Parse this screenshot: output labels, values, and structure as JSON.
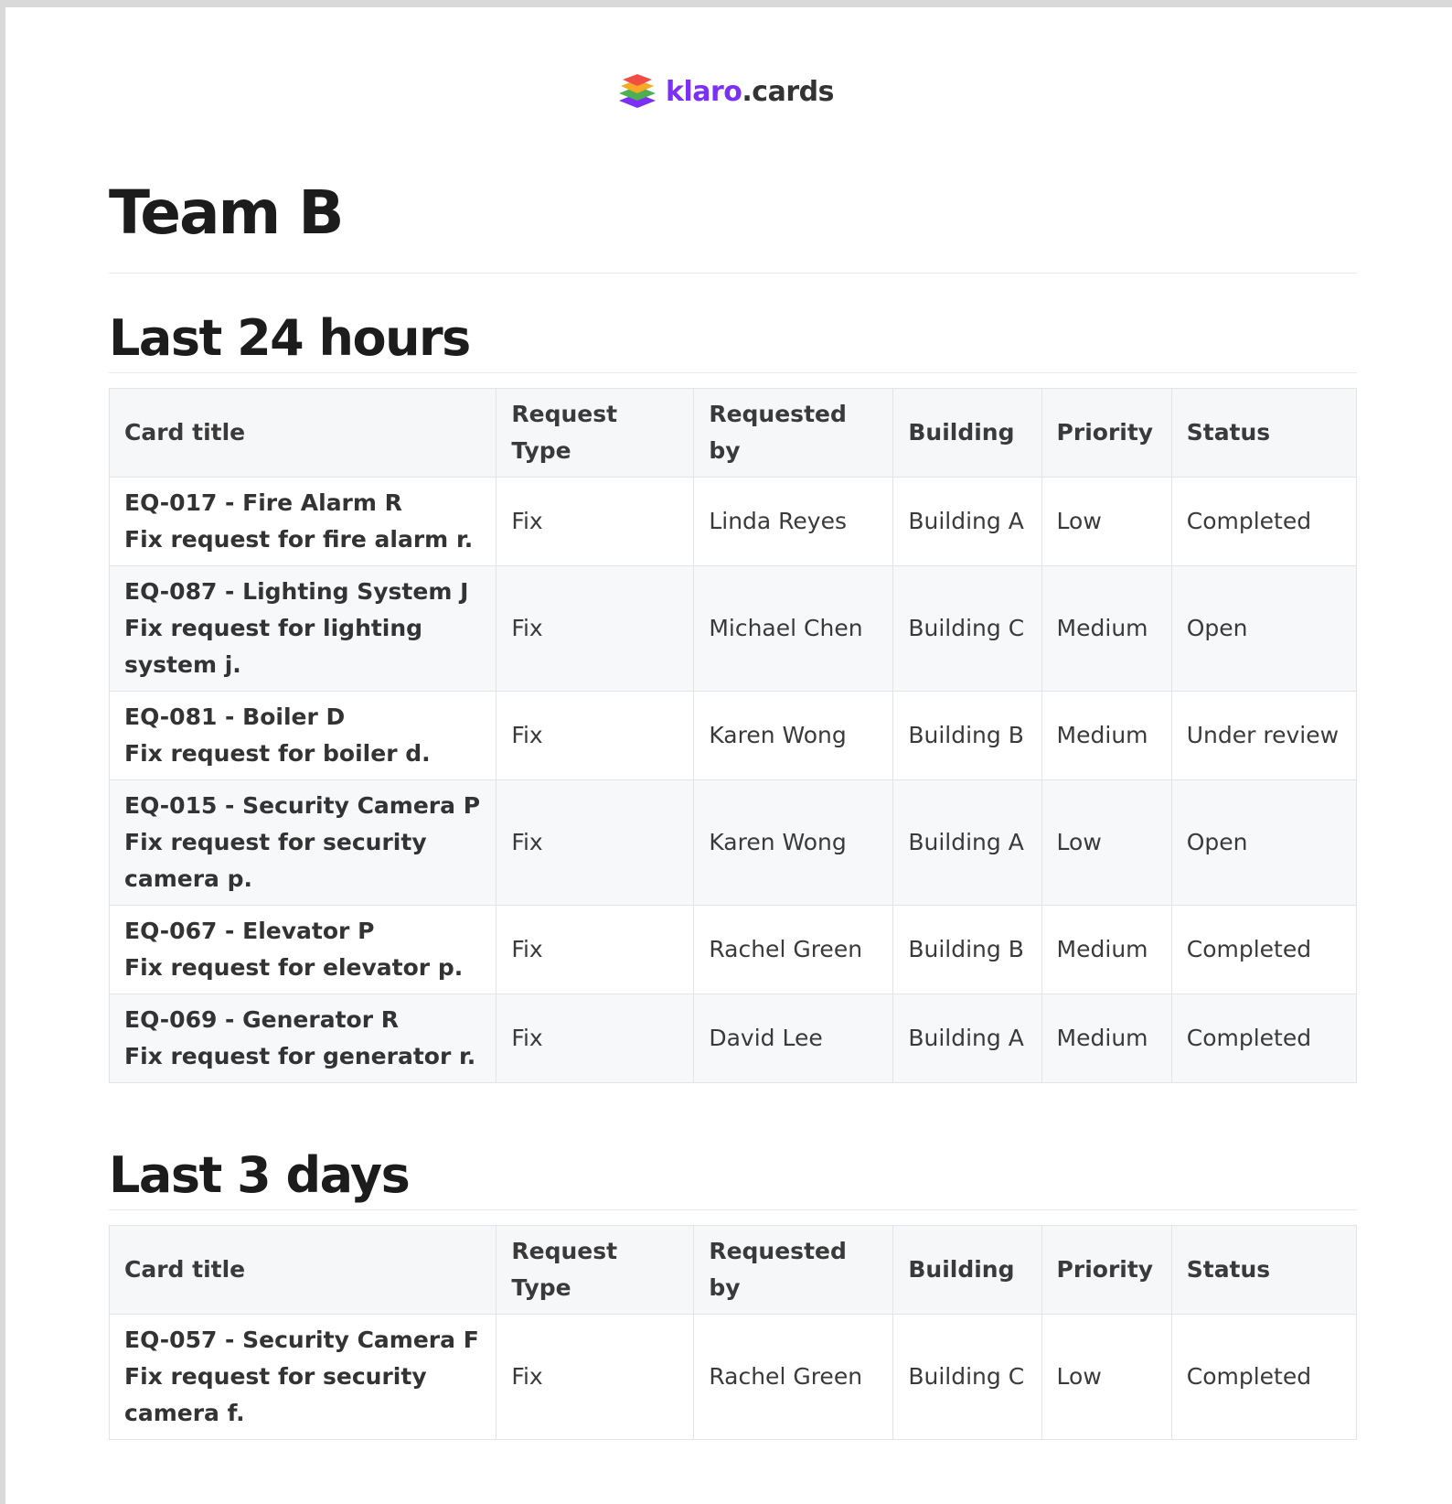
{
  "logo": {
    "brand": "klaro",
    "tld": ".cards",
    "icon": "layers-logo-icon",
    "colors": [
      "#f04e45",
      "#f9a825",
      "#4caf50",
      "#7b2ff7"
    ]
  },
  "page_title": "Team B",
  "columns": [
    "Card title",
    "Request Type",
    "Requested by",
    "Building",
    "Priority",
    "Status"
  ],
  "sections": [
    {
      "heading": "Last 24 hours",
      "rows": [
        {
          "id": "EQ-017 - Fire Alarm R",
          "desc": "Fix request for fire alarm r.",
          "type": "Fix",
          "by": "Linda Reyes",
          "building": "Building A",
          "priority": "Low",
          "status": "Completed"
        },
        {
          "id": "EQ-087 - Lighting System J",
          "desc": "Fix request for lighting system j.",
          "type": "Fix",
          "by": "Michael Chen",
          "building": "Building C",
          "priority": "Medium",
          "status": "Open"
        },
        {
          "id": "EQ-081 - Boiler D",
          "desc": "Fix request for boiler d.",
          "type": "Fix",
          "by": "Karen Wong",
          "building": "Building B",
          "priority": "Medium",
          "status": "Under review"
        },
        {
          "id": "EQ-015 - Security Camera P",
          "desc": "Fix request for security camera p.",
          "type": "Fix",
          "by": "Karen Wong",
          "building": "Building A",
          "priority": "Low",
          "status": "Open"
        },
        {
          "id": "EQ-067 - Elevator P",
          "desc": "Fix request for elevator p.",
          "type": "Fix",
          "by": "Rachel Green",
          "building": "Building B",
          "priority": "Medium",
          "status": "Completed"
        },
        {
          "id": "EQ-069 - Generator R",
          "desc": "Fix request for generator r.",
          "type": "Fix",
          "by": "David Lee",
          "building": "Building A",
          "priority": "Medium",
          "status": "Completed"
        }
      ]
    },
    {
      "heading": "Last 3 days",
      "rows": [
        {
          "id": "EQ-057 - Security Camera F",
          "desc": "Fix request for security camera f.",
          "type": "Fix",
          "by": "Rachel Green",
          "building": "Building C",
          "priority": "Low",
          "status": "Completed"
        }
      ]
    }
  ]
}
